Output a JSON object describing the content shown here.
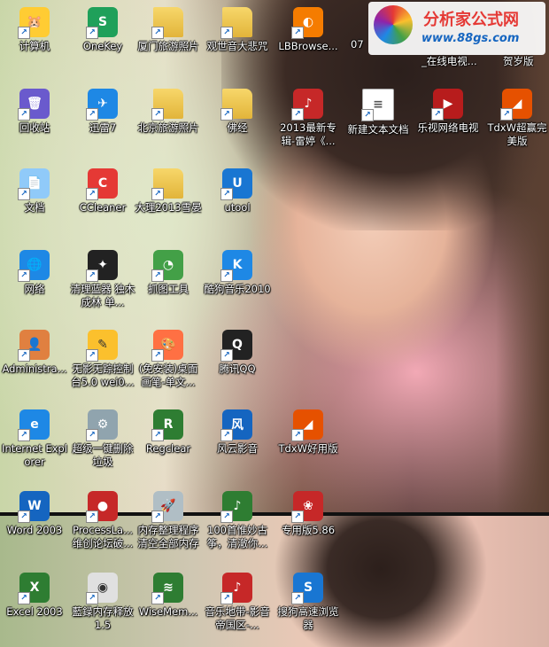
{
  "desktop": {
    "watermark": {
      "title": "分析家公式网",
      "url": "www.88gs.com"
    },
    "edge_labels": {
      "partial_07": "07",
      "online_tv": "_在线电视...",
      "partial_edition": "贺岁版"
    },
    "icons": [
      {
        "label": "计算机",
        "icon": "computer-icon",
        "glyph": "🐹",
        "color": "#ffcc33"
      },
      {
        "label": "OneKey",
        "icon": "onekey-icon",
        "glyph": "S",
        "color": "#1fa05a"
      },
      {
        "label": "厦门旅游照片",
        "icon": "folder-icon",
        "glyph": "",
        "color": "#f2c94c"
      },
      {
        "label": "观世音大悲咒",
        "icon": "folder-icon",
        "glyph": "",
        "color": "#f2c94c"
      },
      {
        "label": "LBBrowse...",
        "icon": "lbbrowser-icon",
        "glyph": "◐",
        "color": "#f57c00"
      },
      {
        "label": "回收站",
        "icon": "recycle-bin-icon",
        "glyph": "🗑",
        "color": "#6a5acd"
      },
      {
        "label": "迅雷7",
        "icon": "thunder-icon",
        "glyph": "✈",
        "color": "#1e88e5"
      },
      {
        "label": "北京旅游照片",
        "icon": "folder-icon",
        "glyph": "",
        "color": "#f2c94c"
      },
      {
        "label": "佛经",
        "icon": "folder-icon",
        "glyph": "",
        "color": "#f2c94c"
      },
      {
        "label": "2013最新专辑-雷婷《...",
        "icon": "media-file-icon",
        "glyph": "♪",
        "color": "#c62828"
      },
      {
        "label": "新建文本文档",
        "icon": "text-file-icon",
        "glyph": "≡",
        "color": "#ffffff"
      },
      {
        "label": "乐视网络电视",
        "icon": "letv-icon",
        "glyph": "▶",
        "color": "#b71c1c"
      },
      {
        "label": "TdxW超赢完美版",
        "icon": "tdxw-icon",
        "glyph": "◢",
        "color": "#e65100"
      },
      {
        "label": "文档",
        "icon": "documents-icon",
        "glyph": "📄",
        "color": "#90caf9"
      },
      {
        "label": "CCleaner",
        "icon": "ccleaner-icon",
        "glyph": "C",
        "color": "#e53935"
      },
      {
        "label": "大理2013雪晏",
        "icon": "folder-icon",
        "glyph": "",
        "color": "#f2c94c"
      },
      {
        "label": "utool",
        "icon": "utool-icon",
        "glyph": "U",
        "color": "#1976d2"
      },
      {
        "label": "网络",
        "icon": "network-icon",
        "glyph": "🌐",
        "color": "#1e88e5"
      },
      {
        "label": "清理蓝器 独木成林 单...",
        "icon": "cleaner-tool-icon",
        "glyph": "✦",
        "color": "#222222"
      },
      {
        "label": "抓图工具",
        "icon": "screenshot-tool-icon",
        "glyph": "◔",
        "color": "#43a047"
      },
      {
        "label": "酷狗音乐2010",
        "icon": "kugou-icon",
        "glyph": "K",
        "color": "#1e88e5"
      },
      {
        "label": "Administra...",
        "icon": "user-folder-icon",
        "glyph": "👤",
        "color": "#e08040"
      },
      {
        "label": "无影无踪控制台5.0 wei0...",
        "icon": "trace-console-icon",
        "glyph": "✎",
        "color": "#fbc02d"
      },
      {
        "label": "(免安装)桌面画笔-单文...",
        "icon": "paint-icon",
        "glyph": "🎨",
        "color": "#ff7043"
      },
      {
        "label": "腾讯QQ",
        "icon": "qq-icon",
        "glyph": "Q",
        "color": "#222222"
      },
      {
        "label": "Internet Explorer",
        "icon": "ie-icon",
        "glyph": "e",
        "color": "#1e88e5"
      },
      {
        "label": "超级一键删除垃圾",
        "icon": "delete-junk-icon",
        "glyph": "⚙",
        "color": "#90a4ae"
      },
      {
        "label": "Regclear",
        "icon": "regclear-icon",
        "glyph": "R",
        "color": "#2e7d32"
      },
      {
        "label": "风云影音",
        "icon": "fengyun-icon",
        "glyph": "风",
        "color": "#1565c0"
      },
      {
        "label": "TdxW好用版",
        "icon": "tdxw-icon",
        "glyph": "◢",
        "color": "#e65100"
      },
      {
        "label": "Word 2003",
        "icon": "word-icon",
        "glyph": "W",
        "color": "#1565c0"
      },
      {
        "label": "ProcessLa... 维创论坛破...",
        "icon": "processlasso-icon",
        "glyph": "●",
        "color": "#c62828"
      },
      {
        "label": "内存整理程序 清空全部内存",
        "icon": "memory-clean-icon",
        "glyph": "🚀",
        "color": "#b0bec5"
      },
      {
        "label": "100首惟妙古筝，清澈你...",
        "icon": "media-file-icon",
        "glyph": "♪",
        "color": "#2e7d32"
      },
      {
        "label": "专用版5.86",
        "icon": "rose-icon",
        "glyph": "❀",
        "color": "#c62828"
      },
      {
        "label": "Excel 2003",
        "icon": "excel-icon",
        "glyph": "X",
        "color": "#2e7d32"
      },
      {
        "label": "藍録内存释放1.5",
        "icon": "memory-release-icon",
        "glyph": "◉",
        "color": "#e0e0e0"
      },
      {
        "label": "WiseMem...",
        "icon": "wisemem-icon",
        "glyph": "≋",
        "color": "#2e7d32"
      },
      {
        "label": "音乐地带-影音帝国区-...",
        "icon": "media-file-icon",
        "glyph": "♪",
        "color": "#c62828"
      },
      {
        "label": "搜狗高速浏览器",
        "icon": "sogou-browser-icon",
        "glyph": "S",
        "color": "#1976d2"
      }
    ]
  }
}
